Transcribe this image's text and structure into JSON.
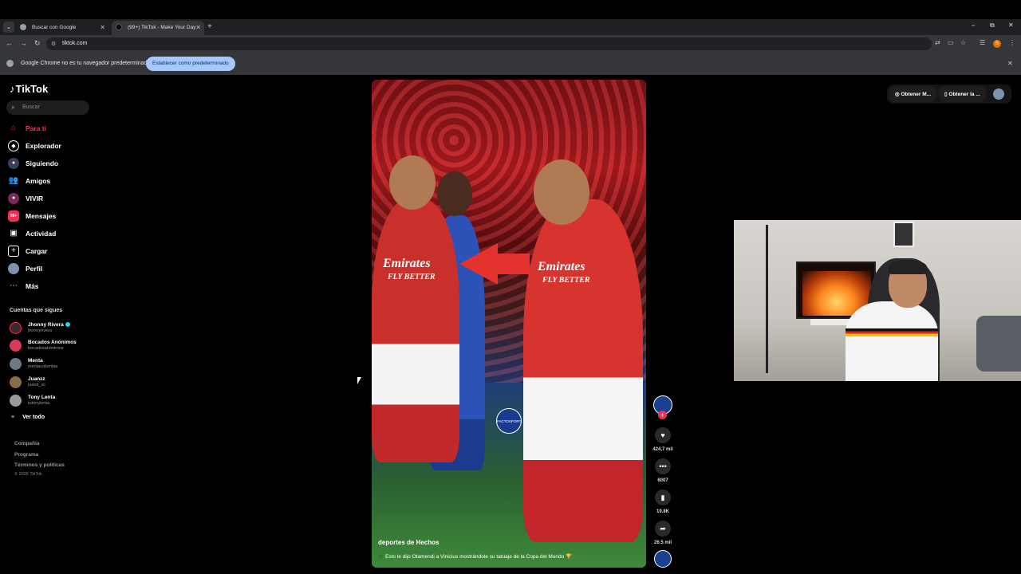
{
  "browser": {
    "tabs": [
      {
        "title": "Buscar con Google",
        "active": false
      },
      {
        "title": "(99+) TikTok - Make Your Day",
        "active": true
      }
    ],
    "url": "tiktok.com",
    "profile_initial": "S",
    "infobar": {
      "message": "Google Chrome no es tu navegador predeterminado",
      "button": "Establecer como predeterminado"
    }
  },
  "tiktok": {
    "logo": "TikTok",
    "search_placeholder": "Buscar",
    "nav": [
      {
        "label": "Para ti",
        "icon": "home-icon"
      },
      {
        "label": "Explorador",
        "icon": "compass-icon"
      },
      {
        "label": "Siguiendo",
        "icon": "following-icon"
      },
      {
        "label": "Amigos",
        "icon": "friends-icon"
      },
      {
        "label": "VIVIR",
        "icon": "live-icon"
      },
      {
        "label": "Mensajes",
        "icon": "messages-icon",
        "badge": "99+"
      },
      {
        "label": "Actividad",
        "icon": "activity-icon"
      },
      {
        "label": "Cargar",
        "icon": "upload-icon"
      },
      {
        "label": "Perfil",
        "icon": "profile-icon"
      },
      {
        "label": "Más",
        "icon": "more-icon"
      }
    ],
    "following_title": "Cuentas que sigues",
    "following": [
      {
        "name": "Jhonny Rivera",
        "handle": "jhonnyrivera",
        "verified": true
      },
      {
        "name": "Bocados Anónimos",
        "handle": "bocadosanónimos",
        "verified": false
      },
      {
        "name": "Menta",
        "handle": "mentacolombia",
        "verified": false
      },
      {
        "name": "Juanzz",
        "handle": "juand_vc",
        "verified": false
      },
      {
        "name": "Tony Lenta",
        "handle": "tutonylenta",
        "verified": false
      }
    ],
    "see_all": "Ver todo",
    "footer": [
      "Compañía",
      "Programa",
      "Términos y políticas"
    ],
    "copyright": "© 2026 TikTok",
    "top_right": {
      "get_app_1": "Obtener M...",
      "get_app_2": "Obtener la ..."
    },
    "video": {
      "author": "deportes de Hechos",
      "caption": "Esto le dijo Otamendi a Vinicius mostrándole su tatuaje de la Copa del Mundo 🏆",
      "sponsor_text": "Emirates",
      "sponsor_sub": "FLY BETTER",
      "watermark": "FACTOSPORT",
      "likes": "424,7 mil",
      "comments": "6007",
      "saves": "19.8K",
      "shares": "26.5 mil"
    }
  }
}
